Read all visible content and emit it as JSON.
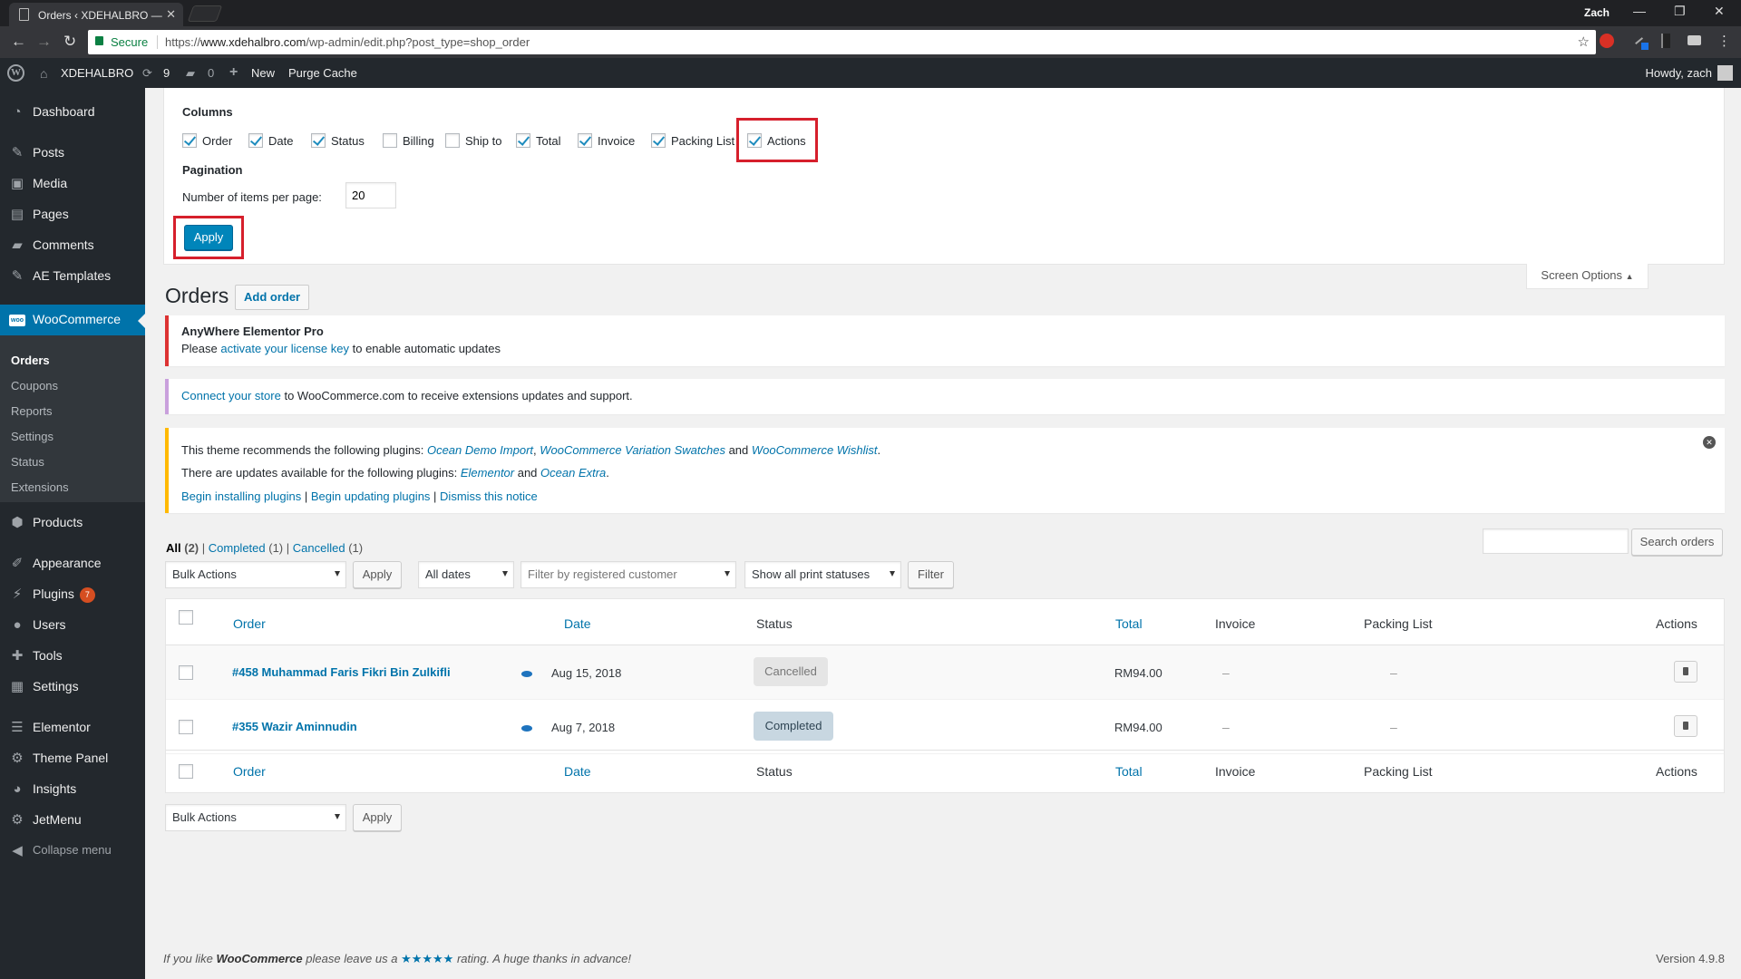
{
  "browser": {
    "tab_title": "Orders ‹ XDEHALBRO —",
    "profile": "Zach",
    "secure_label": "Secure",
    "url_scheme": "https://",
    "url_host": "www.xdehalbro.com",
    "url_path": "/wp-admin/edit.php?post_type=shop_order"
  },
  "adminbar": {
    "site_name": "XDEHALBRO",
    "updates_count": "9",
    "comments_count": "0",
    "new_label": "New",
    "purge_cache_label": "Purge Cache",
    "howdy": "Howdy, zach"
  },
  "sidebar": {
    "dashboard": "Dashboard",
    "posts": "Posts",
    "media": "Media",
    "pages": "Pages",
    "comments": "Comments",
    "ae_templates": "AE Templates",
    "woocommerce": "WooCommerce",
    "woo_icon_text": "woo",
    "sub": [
      "Orders",
      "Coupons",
      "Reports",
      "Settings",
      "Status",
      "Extensions"
    ],
    "products": "Products",
    "appearance": "Appearance",
    "plugins": "Plugins",
    "plugins_badge": "7",
    "users": "Users",
    "tools": "Tools",
    "settings": "Settings",
    "elementor": "Elementor",
    "theme_panel": "Theme Panel",
    "insights": "Insights",
    "jetmenu": "JetMenu",
    "collapse": "Collapse menu"
  },
  "screen_options": {
    "columns_heading": "Columns",
    "columns": [
      {
        "label": "Order",
        "checked": true
      },
      {
        "label": "Date",
        "checked": true
      },
      {
        "label": "Status",
        "checked": true
      },
      {
        "label": "Billing",
        "checked": false
      },
      {
        "label": "Ship to",
        "checked": false
      },
      {
        "label": "Total",
        "checked": true
      },
      {
        "label": "Invoice",
        "checked": true
      },
      {
        "label": "Packing List",
        "checked": true
      },
      {
        "label": "Actions",
        "checked": true
      }
    ],
    "pagination_heading": "Pagination",
    "per_page_label": "Number of items per page:",
    "per_page_value": "20",
    "apply_label": "Apply",
    "tab_label": "Screen Options"
  },
  "page": {
    "title": "Orders",
    "add_order": "Add order"
  },
  "notices": {
    "anywhere_title": "AnyWhere Elementor Pro",
    "anywhere_pre": "Please ",
    "anywhere_link": "activate your license key",
    "anywhere_post": " to enable automatic updates",
    "connect_link": "Connect your store",
    "connect_post": " to WooCommerce.com to receive extensions updates and support.",
    "theme_pre": "This theme recommends the following plugins: ",
    "theme_link1": "Ocean Demo Import",
    "theme_sep1": ", ",
    "theme_link2": "WooCommerce Variation Swatches",
    "theme_and": " and ",
    "theme_link3": "WooCommerce Wishlist",
    "theme_dot": ".",
    "updates_pre": "There are updates available for the following plugins: ",
    "updates_link1": "Elementor",
    "updates_and": " and ",
    "updates_link2": "Ocean Extra",
    "updates_dot": ".",
    "begin_installing": "Begin installing plugins",
    "pipe": " | ",
    "begin_updating": "Begin updating plugins",
    "dismiss": "Dismiss this notice"
  },
  "views": {
    "all": "All",
    "all_count": "(2)",
    "sep": " | ",
    "completed": "Completed",
    "completed_count": "(1)",
    "cancelled": "Cancelled",
    "cancelled_count": "(1)"
  },
  "filters": {
    "bulk_actions": "Bulk Actions",
    "apply": "Apply",
    "all_dates": "All dates",
    "customer_placeholder": "Filter by registered customer",
    "print_statuses": "Show all print statuses",
    "filter": "Filter",
    "search_orders": "Search orders"
  },
  "table": {
    "headers": {
      "order": "Order",
      "date": "Date",
      "status": "Status",
      "total": "Total",
      "invoice": "Invoice",
      "packing_list": "Packing List",
      "actions": "Actions"
    },
    "rows": [
      {
        "order": "#458 Muhammad Faris Fikri Bin Zulkifli",
        "date": "Aug 15, 2018",
        "status": "Cancelled",
        "total": "RM94.00",
        "invoice": "–",
        "packing": "–"
      },
      {
        "order": "#355 Wazir Aminnudin",
        "date": "Aug 7, 2018",
        "status": "Completed",
        "total": "RM94.00",
        "invoice": "–",
        "packing": "–"
      }
    ]
  },
  "footer": {
    "pre": "If you like ",
    "brand": "WooCommerce",
    "mid": " please leave us a ",
    "stars": "★★★★★",
    "post": " rating. A huge thanks in advance!",
    "version": "Version 4.9.8"
  }
}
